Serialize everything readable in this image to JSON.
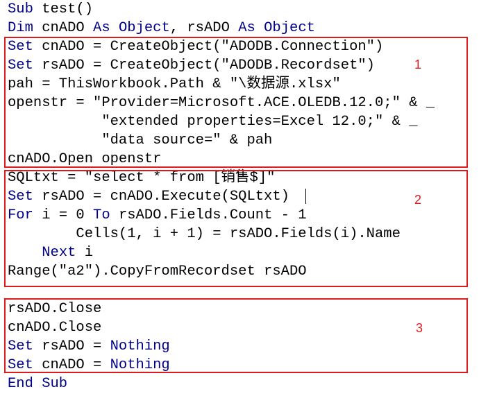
{
  "code": {
    "lines": [
      [
        {
          "t": "Sub",
          "kw": true
        },
        {
          "t": " test()"
        }
      ],
      [
        {
          "t": "Dim",
          "kw": true
        },
        {
          "t": " cnADO "
        },
        {
          "t": "As",
          "kw": true
        },
        {
          "t": " "
        },
        {
          "t": "Object",
          "kw": true
        },
        {
          "t": ", rsADO "
        },
        {
          "t": "As",
          "kw": true
        },
        {
          "t": " "
        },
        {
          "t": "Object",
          "kw": true
        }
      ],
      [
        {
          "t": "Set",
          "kw": true
        },
        {
          "t": " cnADO = CreateObject(\"ADODB.Connection\")"
        }
      ],
      [
        {
          "t": "Set",
          "kw": true
        },
        {
          "t": " rsADO = CreateObject(\"ADODB.Recordset\")"
        }
      ],
      [
        {
          "t": "pah = ThisWorkbook.Path & \"\\数据源.xlsx\""
        }
      ],
      [
        {
          "t": "openstr = \"Provider=Microsoft.ACE.OLEDB.12.0;\" & _"
        }
      ],
      [
        {
          "t": "           \"extended properties=Excel 12.0;\" & _"
        }
      ],
      [
        {
          "t": "           \"data source=\" & pah"
        }
      ],
      [
        {
          "t": "cnADO.Open openstr"
        }
      ],
      [
        {
          "t": "SQLtxt = \"select * from [销售$]\""
        }
      ],
      [
        {
          "t": "Set",
          "kw": true
        },
        {
          "t": " rsADO = cnADO.Execute(SQLtxt)"
        }
      ],
      [
        {
          "t": "For",
          "kw": true
        },
        {
          "t": " i = 0 "
        },
        {
          "t": "To",
          "kw": true
        },
        {
          "t": " rsADO.Fields.Count - 1"
        }
      ],
      [
        {
          "t": "        Cells(1, i + 1) = rsADO.Fields(i).Name"
        }
      ],
      [
        {
          "t": "    "
        },
        {
          "t": "Next",
          "kw": true
        },
        {
          "t": " i"
        }
      ],
      [
        {
          "t": "Range(\"a2\").CopyFromRecordset rsADO"
        }
      ],
      [
        {
          "t": ""
        }
      ],
      [
        {
          "t": "rsADO.Close"
        }
      ],
      [
        {
          "t": "cnADO.Close"
        }
      ],
      [
        {
          "t": "Set",
          "kw": true
        },
        {
          "t": " rsADO = "
        },
        {
          "t": "Nothing",
          "kw": true
        }
      ],
      [
        {
          "t": "Set",
          "kw": true
        },
        {
          "t": " cnADO = "
        },
        {
          "t": "Nothing",
          "kw": true
        }
      ],
      [
        {
          "t": "End Sub",
          "kw": true
        }
      ]
    ]
  },
  "annotations": {
    "box1_label": "1",
    "box2_label": "2",
    "box3_label": "3"
  },
  "colors": {
    "keyword": "#00008b",
    "text": "#000000",
    "annotation": "#e0191c",
    "background": "#ffffff"
  }
}
